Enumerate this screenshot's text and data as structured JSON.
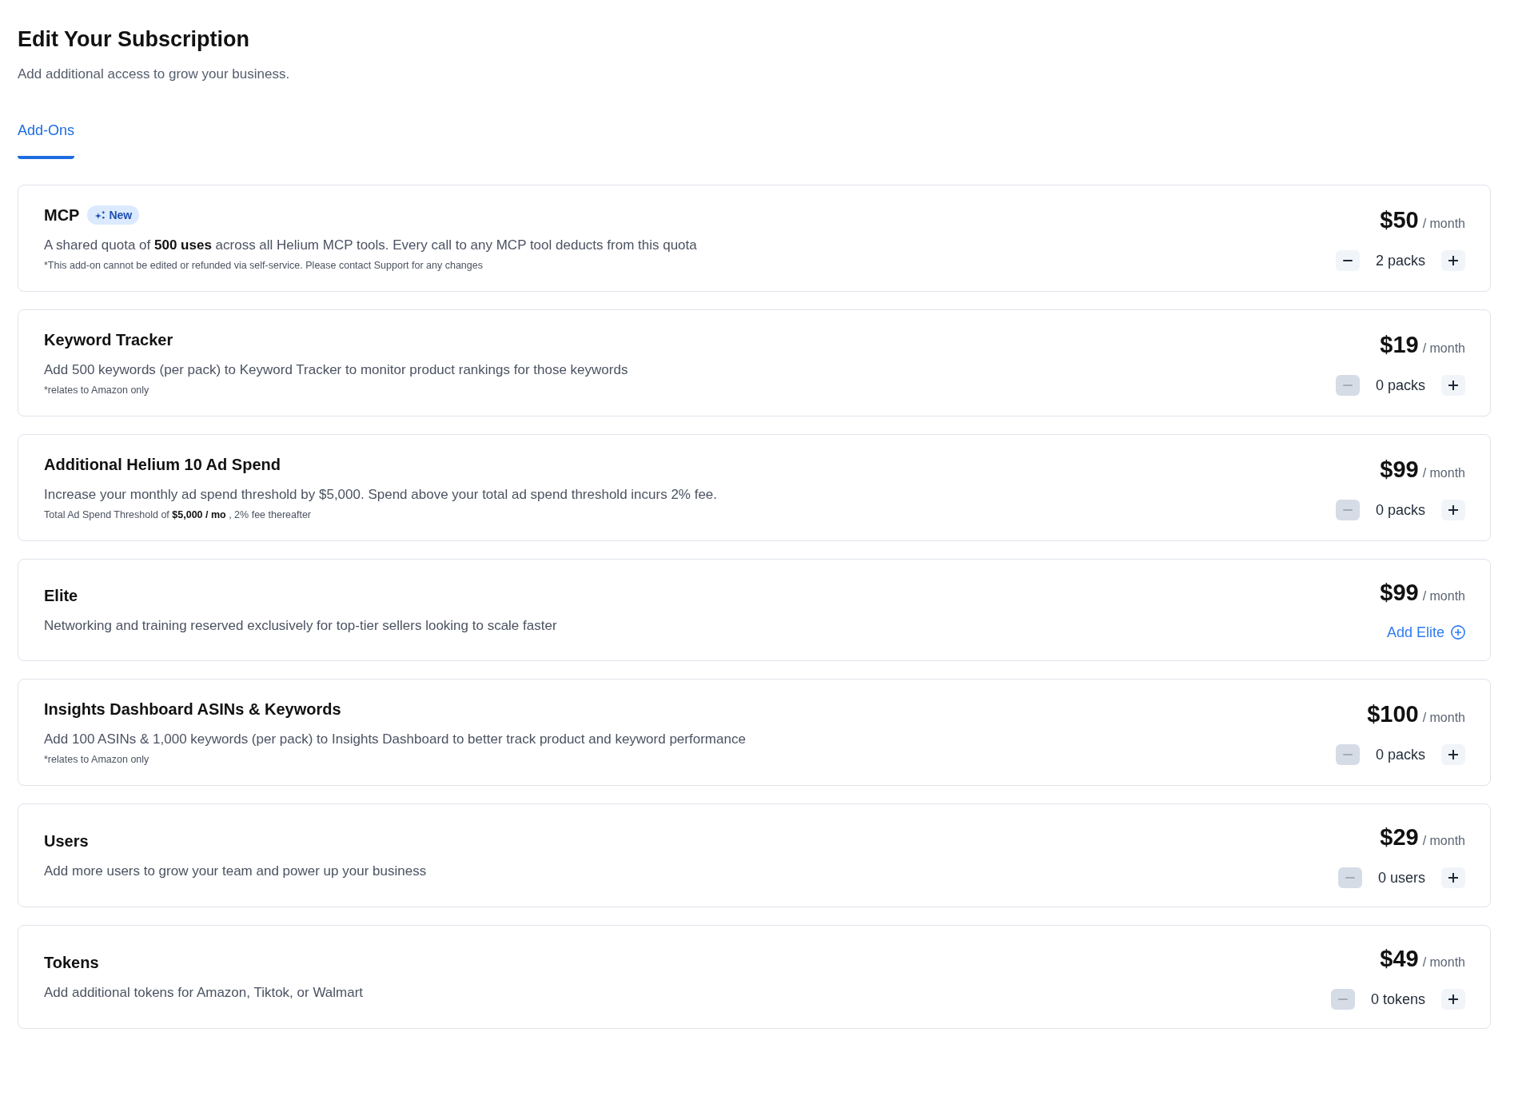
{
  "header": {
    "title": "Edit Your Subscription",
    "subtitle": "Add additional access to grow your business."
  },
  "tabs": [
    {
      "label": "Add-Ons",
      "selected": true
    }
  ],
  "addons": [
    {
      "kind": "stepper",
      "name": "MCP",
      "badge": "New",
      "description": "A shared quota of **500 uses** across all Helium MCP tools. Every call to any MCP tool deducts from this quota",
      "note": "*This add-on cannot be edited or refunded via self-service. Please contact Support for any changes",
      "price": "$50",
      "period": "/ month",
      "quantity": "2 packs",
      "decrement_disabled": false
    },
    {
      "kind": "stepper",
      "name": "Keyword Tracker",
      "description": "Add 500 keywords (per pack) to Keyword Tracker to monitor product rankings for those keywords",
      "note": "*relates to Amazon only",
      "price": "$19",
      "period": "/ month",
      "quantity": "0 packs",
      "decrement_disabled": true
    },
    {
      "kind": "stepper",
      "name": "Additional Helium 10 Ad Spend",
      "description": "Increase your monthly ad spend threshold by $5,000. Spend above your total ad spend threshold incurs 2% fee.",
      "note": "Total Ad Spend Threshold of **$5,000 / mo** , 2% fee thereafter",
      "price": "$99",
      "period": "/ month",
      "quantity": "0 packs",
      "decrement_disabled": true
    },
    {
      "kind": "add",
      "name": "Elite",
      "description": "Networking and training reserved exclusively for top-tier sellers looking to scale faster",
      "price": "$99",
      "period": "/ month",
      "action": "Add Elite"
    },
    {
      "kind": "stepper",
      "name": "Insights Dashboard ASINs & Keywords",
      "description": "Add 100 ASINs & 1,000 keywords (per pack) to Insights Dashboard to better track product and keyword performance",
      "note": "*relates to Amazon only",
      "price": "$100",
      "period": "/ month",
      "quantity": "0 packs",
      "decrement_disabled": true
    },
    {
      "kind": "stepper",
      "name": "Users",
      "description": "Add more users to grow your team and power up your business",
      "price": "$29",
      "period": "/ month",
      "quantity": "0 users",
      "decrement_disabled": true
    },
    {
      "kind": "stepper",
      "name": "Tokens",
      "description": "Add additional tokens for Amazon, Tiktok, or Walmart",
      "price": "$49",
      "period": "/ month",
      "quantity": "0 tokens",
      "decrement_disabled": true
    }
  ]
}
